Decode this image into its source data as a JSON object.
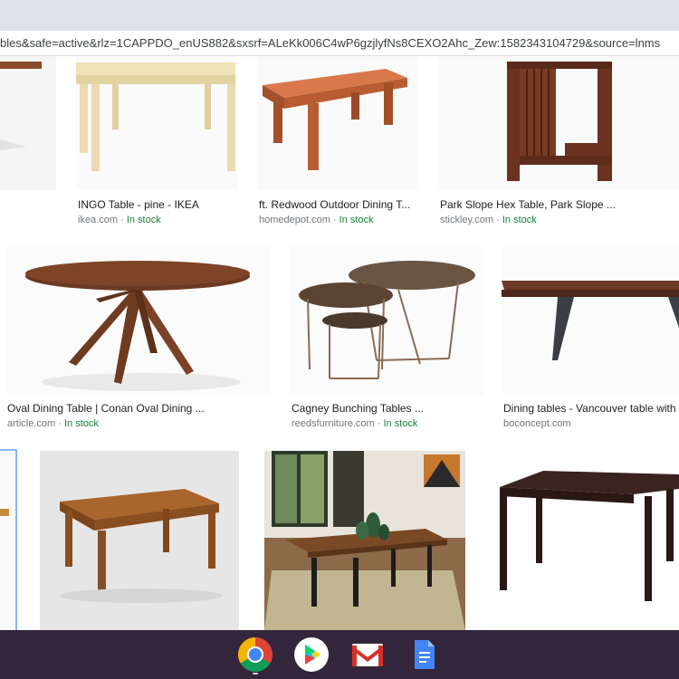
{
  "browser": {
    "url": "bles&safe=active&rlz=1CAPPDO_enUS882&sxsrf=ALeKk006C4wP6gzjlyfNs8CEXO2Ahc_Zew:1582343104729&source=lnms"
  },
  "results": [
    {
      "title": "INGO Table - pine - IKEA",
      "source": "ikea.com",
      "stock": "In stock"
    },
    {
      "title": "ft. Redwood Outdoor Dining T...",
      "source": "homedepot.com",
      "stock": "In stock"
    },
    {
      "title": "Park Slope Hex Table, Park Slope ...",
      "source": "stickley.com",
      "stock": "In stock"
    },
    {
      "title": "Oval Dining Table | Conan Oval Dining ...",
      "source": "article.com",
      "stock": "In stock"
    },
    {
      "title": "Cagney Bunching Tables ...",
      "source": "reedsfurniture.com",
      "stock": "In stock"
    },
    {
      "title": "Dining tables - Vancouver table with ...",
      "source": "boconcept.com",
      "stock": ""
    }
  ],
  "separator": " · ",
  "shelf": {
    "apps": [
      {
        "name": "Chrome",
        "icon": "chrome-icon"
      },
      {
        "name": "Play Store",
        "icon": "play-store-icon"
      },
      {
        "name": "Gmail",
        "icon": "gmail-icon"
      },
      {
        "name": "Docs",
        "icon": "docs-icon"
      }
    ]
  },
  "colors": {
    "shelf": "#33253a",
    "in_stock": "#188038",
    "source": "#70757a",
    "caption": "#202124"
  }
}
